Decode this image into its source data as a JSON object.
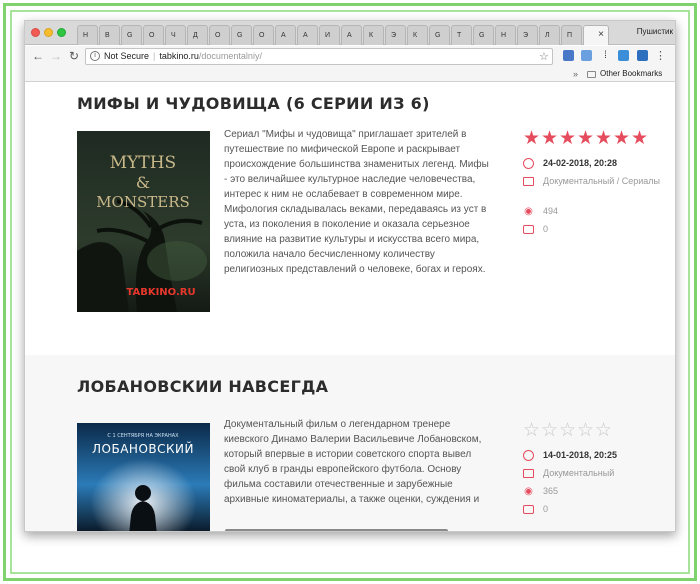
{
  "browser": {
    "tabs": [
      "Н",
      "В",
      "G",
      "О",
      "Ч",
      "Д",
      "О",
      "G",
      "О",
      "А",
      "А",
      "И",
      "А",
      "К",
      "Э",
      "К",
      "G",
      "Т",
      "G",
      "Н",
      "Э",
      "Л",
      "П"
    ],
    "active_tab_close": "×",
    "profile_name": "Пушистик",
    "security_label": "Not Secure",
    "url_domain": "tabkino.ru",
    "url_path": "/documentalniy/",
    "bookmarks_label": "Other Bookmarks"
  },
  "articles": [
    {
      "title": "МИФЫ И ЧУДОВИЩА (6 СЕРИИ ИЗ 6)",
      "poster_line1": "MYTHS",
      "poster_line2": "&",
      "poster_line3": "MONSTERS",
      "poster_watermark": "TABKINO.RU",
      "description": "Сериал \"Мифы и чудовища\" приглашает зрителей в путешествие по мифической Европе и раскрывает происхождение большинства знаменитых легенд. Мифы - это величайшее культурное наследие человечества, интерес к ним не ослабевает в современном мире. Мифология складывалась веками, передаваясь из уст в уста, из поколения в поколение и оказала серьезное влияние на развитие культуры и искусства всего мира, положила начало бесчисленному количеству религиозных представлений о человеке, богах и героях.",
      "rating": 7,
      "rating_max": 7,
      "date": "24-02-2018, 20:28",
      "category": "Документальный / Сериалы",
      "views": "494",
      "comments": "0"
    },
    {
      "title": "ЛОБАНОВСКИИ НАВСЕГДА",
      "poster_small_text": "С 1 СЕНТЯБРЯ НА ЭКРАНАХ",
      "poster_name": "ЛОБАНОВСКИЙ",
      "description": "Документальный фильм о легендарном тренере киевского Динамо Валерии Васильевиче Лобановском, который впервые в истории советского спорта вывел свой клуб в гранды европейского футбола. Основу фильма составили отечественные и зарубежные архивные киноматериалы, а также оценки, суждения и",
      "rating": 0,
      "rating_max": 5,
      "date": "14-01-2018, 20:25",
      "category": "Документальный",
      "views": "365",
      "comments": "0"
    }
  ],
  "colors": {
    "accent": "#e54c5e",
    "frame_green": "#7ed36c"
  }
}
